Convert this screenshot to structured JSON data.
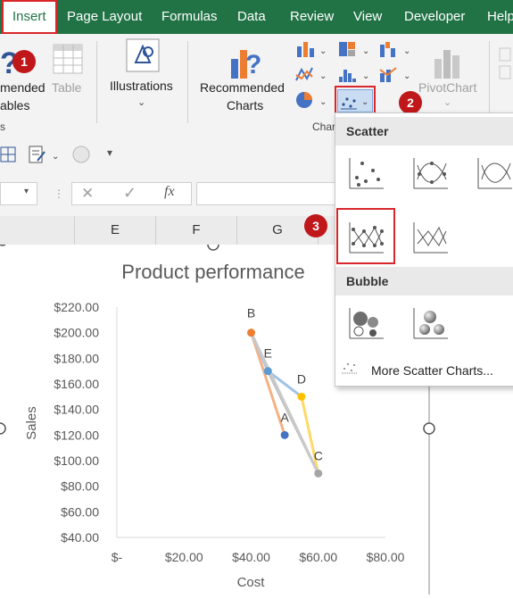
{
  "tabs": [
    "Insert",
    "Page Layout",
    "Formulas",
    "Data",
    "Review",
    "View",
    "Developer",
    "Help"
  ],
  "ribbon": {
    "pivot_label_line1": "mended",
    "pivot_label_line2": "ables",
    "table_label": "Table",
    "illustrations_label": "Illustrations",
    "recommended_charts_line1": "Recommended",
    "recommended_charts_line2": "Charts",
    "charts_group_label": "Char",
    "pivotchart_label": "PivotChart",
    "group_fragment": "s"
  },
  "badges": [
    "1",
    "2",
    "3"
  ],
  "columns": [
    "E",
    "F",
    "G"
  ],
  "dropdown": {
    "scatter_header": "Scatter",
    "bubble_header": "Bubble",
    "more_label": "More Scatter Charts..."
  },
  "chart_data": {
    "type": "scatter",
    "title": "Product performance",
    "xlabel": "Cost",
    "ylabel": "Sales",
    "xlim": [
      0,
      80
    ],
    "ylim": [
      40,
      220
    ],
    "x_ticks": [
      "$-",
      "$20.00",
      "$40.00",
      "$60.00",
      "$80.00"
    ],
    "y_ticks": [
      "$40.00",
      "$60.00",
      "$80.00",
      "$100.00",
      "$120.00",
      "$140.00",
      "$160.00",
      "$180.00",
      "$200.00",
      "$220.00"
    ],
    "points": [
      {
        "label": "A",
        "x": 50,
        "y": 120,
        "color": "#4472c4"
      },
      {
        "label": "B",
        "x": 40,
        "y": 200,
        "color": "#ed7d31"
      },
      {
        "label": "C",
        "x": 60,
        "y": 90,
        "color": "#a5a5a5"
      },
      {
        "label": "D",
        "x": 55,
        "y": 150,
        "color": "#ffc000"
      },
      {
        "label": "E",
        "x": 45,
        "y": 170,
        "color": "#5b9bd5"
      }
    ],
    "segments": [
      {
        "from": "B",
        "to": "A",
        "color": "#f4b183"
      },
      {
        "from": "B",
        "to": "E",
        "color": "#a9c4e8"
      },
      {
        "from": "E",
        "to": "C",
        "color": "#bfbfbf"
      },
      {
        "from": "E",
        "to": "D",
        "color": "#9dc3e6"
      },
      {
        "from": "D",
        "to": "C",
        "color": "#ffd966"
      },
      {
        "from": "B",
        "to": "C",
        "color": "#c9c9c9"
      }
    ]
  }
}
